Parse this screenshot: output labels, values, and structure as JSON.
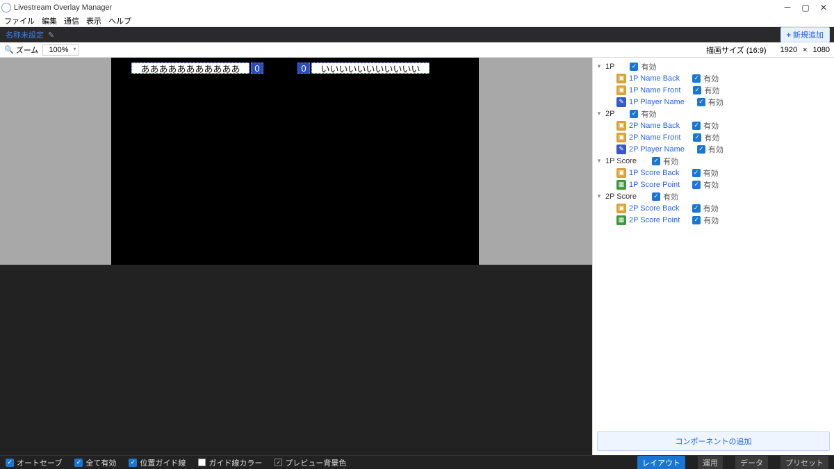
{
  "title": "Livestream Overlay Manager",
  "menu": [
    "ファイル",
    "編集",
    "通信",
    "表示",
    "ヘルプ"
  ],
  "tab": {
    "name": "名称未設定",
    "add_btn": "新規追加"
  },
  "toolbar": {
    "zoom_label": "ズーム",
    "zoom_value": "100%",
    "size_label": "描画サイズ (16:9)",
    "size_w": "1920",
    "size_x": "×",
    "size_h": "1080"
  },
  "overlays": {
    "p1_name": "あああああああああああ",
    "p1_score": "0",
    "p2_score": "0",
    "p2_name": "いいいいいいいいいいい"
  },
  "tree": [
    {
      "type": "group",
      "name": "1P",
      "enabled": "有効",
      "children": [
        {
          "icon": "img",
          "name": "1P Name Back",
          "enabled": "有効"
        },
        {
          "icon": "img",
          "name": "1P Name Front",
          "enabled": "有効"
        },
        {
          "icon": "txt",
          "name": "1P Player Name",
          "enabled": "有効"
        }
      ]
    },
    {
      "type": "group",
      "name": "2P",
      "enabled": "有効",
      "children": [
        {
          "icon": "img",
          "name": "2P Name Back",
          "enabled": "有効"
        },
        {
          "icon": "img",
          "name": "2P Name Front",
          "enabled": "有効"
        },
        {
          "icon": "txt",
          "name": "2P Player Name",
          "enabled": "有効"
        }
      ]
    },
    {
      "type": "group",
      "name": "1P Score",
      "enabled": "有効",
      "children": [
        {
          "icon": "img",
          "name": "1P Score Back",
          "enabled": "有効"
        },
        {
          "icon": "num",
          "name": "1P Score Point",
          "enabled": "有効"
        }
      ]
    },
    {
      "type": "group",
      "name": "2P Score",
      "enabled": "有効",
      "children": [
        {
          "icon": "img",
          "name": "2P Score Back",
          "enabled": "有効"
        },
        {
          "icon": "num",
          "name": "2P Score Point",
          "enabled": "有効"
        }
      ]
    }
  ],
  "add_component": "コンポーネントの追加",
  "footer": {
    "autosave": "オートセーブ",
    "all_enabled": "全て有効",
    "guide": "位置ガイド線",
    "guide_color": "ガイド線カラー",
    "preview_bg": "プレビュー背景色",
    "modes": [
      "レイアウト",
      "運用",
      "データ",
      "プリセット"
    ],
    "active_mode": 0
  }
}
